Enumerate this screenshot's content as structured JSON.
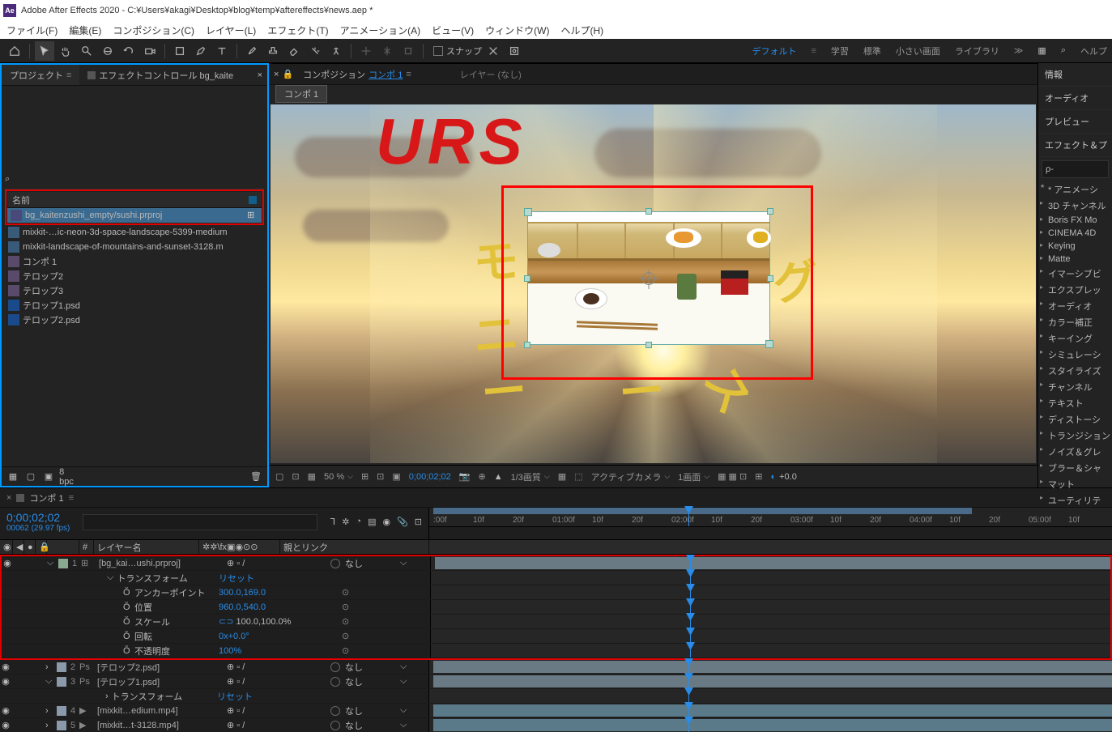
{
  "titlebar": {
    "app": "Ae",
    "title": "Adobe After Effects 2020 - C:¥Users¥akagi¥Desktop¥blog¥temp¥aftereffects¥news.aep *"
  },
  "menubar": [
    "ファイル(F)",
    "編集(E)",
    "コンポジション(C)",
    "レイヤー(L)",
    "エフェクト(T)",
    "アニメーション(A)",
    "ビュー(V)",
    "ウィンドウ(W)",
    "ヘルプ(H)"
  ],
  "toolbar": {
    "snap": "スナップ"
  },
  "workspaces": {
    "default": "デフォルト",
    "learn": "学習",
    "standard": "標準",
    "small": "小さい画面",
    "library": "ライブラリ",
    "help": "ヘルプ"
  },
  "project": {
    "tab_project": "プロジェクト",
    "tab_effect": "エフェクトコントロール bg_kaite",
    "name_hdr": "名前",
    "bpc": "8 bpc",
    "items": [
      {
        "name": "bg_kaitenzushi_empty/sushi.prproj",
        "type": "proj",
        "sel": true,
        "flow": true
      },
      {
        "name": "mixkit-…ic-neon-3d-space-landscape-5399-medium",
        "type": "vid"
      },
      {
        "name": "mixkit-landscape-of-mountains-and-sunset-3128.m",
        "type": "vid"
      },
      {
        "name": "コンポ 1",
        "type": "comp"
      },
      {
        "name": "テロップ2",
        "type": "comp"
      },
      {
        "name": "テロップ3",
        "type": "comp"
      },
      {
        "name": "テロップ1.psd",
        "type": "psd"
      },
      {
        "name": "テロップ2.psd",
        "type": "psd"
      }
    ]
  },
  "comp": {
    "tab_label": "コンポジション",
    "tab_name": "コンポ 1",
    "layer_tab": "レイヤー (なし)",
    "crumb": "コンポ 1",
    "viewer": {
      "zoom": "50 %",
      "time": "0;00;02;02",
      "quality": "1/3画質",
      "camera": "アクティブカメラ",
      "view": "1画面",
      "exposure": "+0.0"
    },
    "red_text": "URS"
  },
  "right_panel": {
    "info": "情報",
    "audio": "オーディオ",
    "preview": "プレビュー",
    "effects": "エフェクト＆プ",
    "search": "ρ-",
    "cats": [
      "* アニメーシ",
      "3D チャンネル",
      "Boris FX Mo",
      "CINEMA 4D",
      "Keying",
      "Matte",
      "イマーシブビ",
      "エクスプレッ",
      "オーディオ",
      "カラー補正",
      "キーイング",
      "シミュレーシ",
      "スタイライズ",
      "チャンネル",
      "テキスト",
      "ディストーシ",
      "トランジション",
      "ノイズ＆グレ",
      "ブラー＆シャ",
      "マット",
      "ユーティリテ"
    ]
  },
  "timeline": {
    "tab": "コンポ 1",
    "timecode": "0;00;02;02",
    "frame": "00062 (29.97 fps)",
    "cols": {
      "layer": "レイヤー名",
      "parent": "親とリンク"
    },
    "ruler": [
      ":00f",
      "10f",
      "20f",
      "01:00f",
      "10f",
      "20f",
      "02:00f",
      "10f",
      "20f",
      "03:00f",
      "10f",
      "20f",
      "04:00f",
      "10f",
      "20f",
      "05:00f",
      "10f"
    ],
    "layers": [
      {
        "n": "1",
        "name": "bg_kai…ushi.prproj",
        "parent": "なし",
        "color": "g",
        "hl": true
      },
      {
        "n": "2",
        "name": "テロップ2.psd",
        "parent": "なし",
        "color": "b"
      },
      {
        "n": "3",
        "name": "テロップ1.psd",
        "parent": "なし",
        "color": "b"
      },
      {
        "n": "4",
        "name": "mixkit…edium.mp4",
        "parent": "なし",
        "color": "b"
      },
      {
        "n": "5",
        "name": "mixkit…t-3128.mp4",
        "parent": "なし",
        "color": "b"
      }
    ],
    "transform": {
      "label": "トランスフォーム",
      "reset": "リセット",
      "props": [
        {
          "label": "アンカーポイント",
          "val": "300.0,169.0"
        },
        {
          "label": "位置",
          "val": "960.0,540.0"
        },
        {
          "label": "スケール",
          "val": "100.0,100.0%",
          "link": true
        },
        {
          "label": "回転",
          "val": "0x+0.0°"
        },
        {
          "label": "不透明度",
          "val": "100%"
        }
      ]
    }
  }
}
